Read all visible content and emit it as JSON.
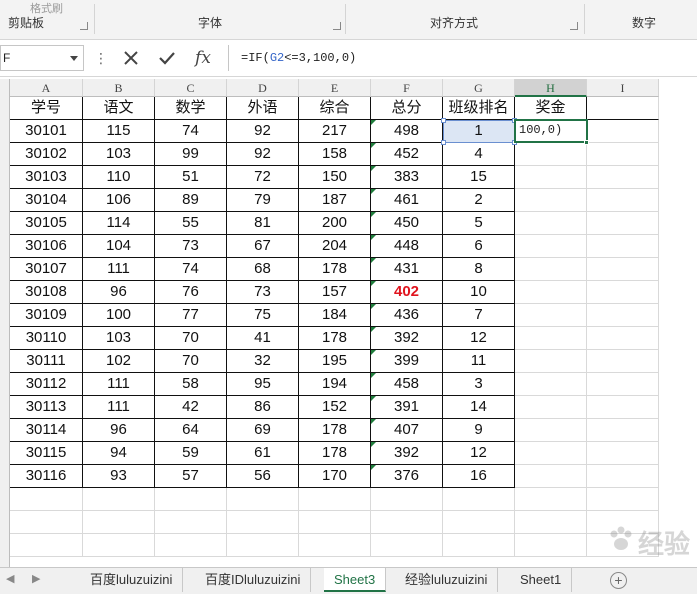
{
  "ribbon": {
    "top_fragment": "格式刷",
    "groups": [
      {
        "label": "剪贴板"
      },
      {
        "label": "字体"
      },
      {
        "label": "对齐方式"
      },
      {
        "label": "数字"
      }
    ]
  },
  "formula_bar": {
    "name_box": "F",
    "formula_prefix": "=IF(",
    "formula_ref": "G2",
    "formula_suffix": "<=3,100,0)",
    "fx_label": "fx"
  },
  "columns": [
    "A",
    "B",
    "C",
    "D",
    "E",
    "F",
    "G",
    "H",
    "I"
  ],
  "header_row": [
    "学号",
    "语文",
    "数学",
    "外语",
    "综合",
    "总分",
    "班级排名",
    "奖金"
  ],
  "rows": [
    [
      "30101",
      "115",
      "74",
      "92",
      "217",
      "498",
      "1"
    ],
    [
      "30102",
      "103",
      "99",
      "92",
      "158",
      "452",
      "4"
    ],
    [
      "30103",
      "110",
      "51",
      "72",
      "150",
      "383",
      "15"
    ],
    [
      "30104",
      "106",
      "89",
      "79",
      "187",
      "461",
      "2"
    ],
    [
      "30105",
      "114",
      "55",
      "81",
      "200",
      "450",
      "5"
    ],
    [
      "30106",
      "104",
      "73",
      "67",
      "204",
      "448",
      "6"
    ],
    [
      "30107",
      "111",
      "74",
      "68",
      "178",
      "431",
      "8"
    ],
    [
      "30108",
      "96",
      "76",
      "73",
      "157",
      "402",
      "10"
    ],
    [
      "30109",
      "100",
      "77",
      "75",
      "184",
      "436",
      "7"
    ],
    [
      "30110",
      "103",
      "70",
      "41",
      "178",
      "392",
      "12"
    ],
    [
      "30111",
      "102",
      "70",
      "32",
      "195",
      "399",
      "11"
    ],
    [
      "30112",
      "111",
      "58",
      "95",
      "194",
      "458",
      "3"
    ],
    [
      "30113",
      "111",
      "42",
      "86",
      "152",
      "391",
      "14"
    ],
    [
      "30114",
      "96",
      "64",
      "69",
      "178",
      "407",
      "9"
    ],
    [
      "30115",
      "94",
      "59",
      "61",
      "178",
      "392",
      "12"
    ],
    [
      "30116",
      "93",
      "57",
      "56",
      "170",
      "376",
      "16"
    ]
  ],
  "active_cell_text": "100,0)",
  "highlight_value": "402",
  "colors": {
    "accent": "#217346",
    "highlight": "#e0141e",
    "reference": "#3465c8"
  },
  "sheet_tabs": [
    "百度luluzuizini",
    "百度IDluluzuizini",
    "Sheet3",
    "经验luluzuizini",
    "Sheet1"
  ],
  "active_tab": "Sheet3",
  "watermark": "经验"
}
